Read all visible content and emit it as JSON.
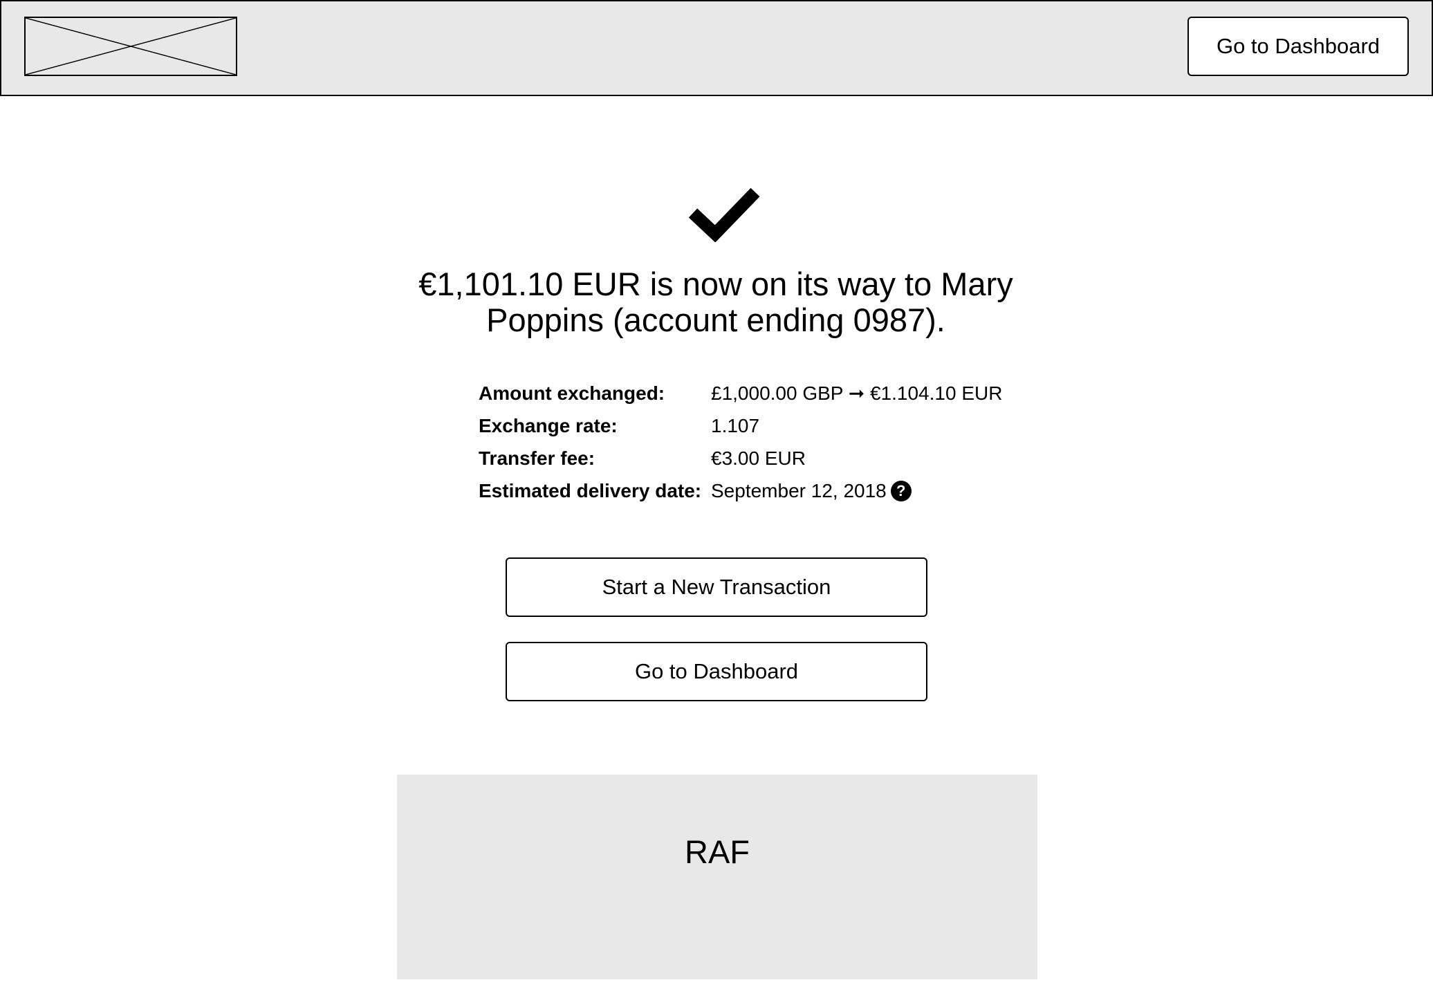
{
  "header": {
    "dashboard_button": "Go to Dashboard"
  },
  "icons": {
    "logo": "image-placeholder-icon",
    "success": "checkmark-icon",
    "help": "question-circle-icon"
  },
  "confirmation": {
    "headline": "€1,101.10 EUR is now on its way to Mary Poppins (account ending 0987)."
  },
  "details": {
    "amount_label": "Amount exchanged:",
    "amount_value": "£1,000.00 GBP ➞ €1.104.10 EUR",
    "rate_label": "Exchange rate:",
    "rate_value": "1.107",
    "fee_label": "Transfer fee:",
    "fee_value": "€3.00 EUR",
    "delivery_label": "Estimated delivery date:",
    "delivery_value": "September 12, 2018",
    "help_glyph": "?"
  },
  "actions": {
    "new_transaction": "Start a New Transaction",
    "dashboard": "Go to Dashboard"
  },
  "raf": {
    "label": "RAF"
  },
  "colors": {
    "panel_gray": "#e8e8e8",
    "border": "#000000"
  }
}
